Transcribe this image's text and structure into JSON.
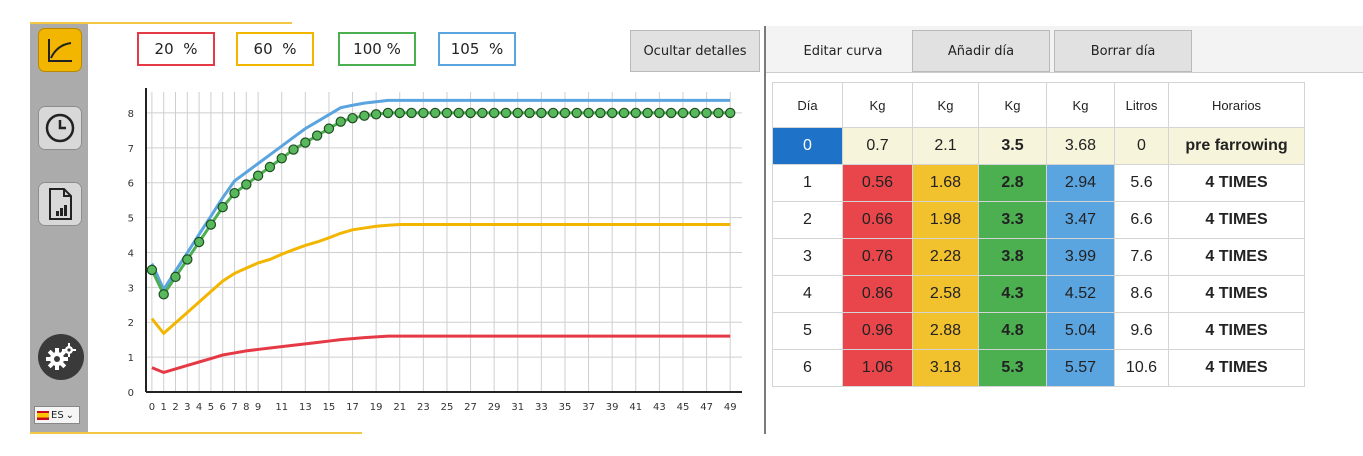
{
  "sidebar": {
    "icons": [
      "curve-chart-icon",
      "clock-icon",
      "report-file-icon",
      "gear-icon"
    ],
    "language_label": "ES"
  },
  "percent_filters": [
    {
      "value": "20",
      "unit": "%",
      "color": "#e63946"
    },
    {
      "value": "60",
      "unit": "%",
      "color": "#f2b600"
    },
    {
      "value": "100",
      "unit": "%",
      "color": "#4caf50"
    },
    {
      "value": "105",
      "unit": "%",
      "color": "#5aa4e0"
    }
  ],
  "buttons": {
    "hide_details": "Ocultar detalles",
    "edit_curve": "Editar curva",
    "add_day": "Añadir día",
    "delete_day": "Borrar día"
  },
  "table": {
    "headers": [
      "Día",
      "Kg",
      "Kg",
      "Kg",
      "Kg",
      "Litros",
      "Horarios"
    ],
    "rows": [
      [
        "0",
        "0.7",
        "2.1",
        "3.5",
        "3.68",
        "0",
        "pre farrowing"
      ],
      [
        "1",
        "0.56",
        "1.68",
        "2.8",
        "2.94",
        "5.6",
        "4 TIMES"
      ],
      [
        "2",
        "0.66",
        "1.98",
        "3.3",
        "3.47",
        "6.6",
        "4 TIMES"
      ],
      [
        "3",
        "0.76",
        "2.28",
        "3.8",
        "3.99",
        "7.6",
        "4 TIMES"
      ],
      [
        "4",
        "0.86",
        "2.58",
        "4.3",
        "4.52",
        "8.6",
        "4 TIMES"
      ],
      [
        "5",
        "0.96",
        "2.88",
        "4.8",
        "5.04",
        "9.6",
        "4 TIMES"
      ],
      [
        "6",
        "1.06",
        "3.18",
        "5.3",
        "5.57",
        "10.6",
        "4 TIMES"
      ]
    ],
    "column_colors": [
      "",
      "#e8464b",
      "#f2c12e",
      "#4caf50",
      "#5aa4e0",
      "",
      ""
    ]
  },
  "chart_data": {
    "type": "line",
    "x": [
      0,
      1,
      2,
      3,
      4,
      5,
      6,
      7,
      8,
      9,
      10,
      11,
      12,
      13,
      14,
      15,
      16,
      17,
      18,
      19,
      20,
      21,
      22,
      23,
      24,
      25,
      26,
      27,
      28,
      29,
      30,
      31,
      32,
      33,
      34,
      35,
      36,
      37,
      38,
      39,
      40,
      41,
      42,
      43,
      44,
      45,
      46,
      47,
      48,
      49
    ],
    "x_ticks": [
      0,
      1,
      2,
      3,
      4,
      5,
      6,
      7,
      8,
      9,
      11,
      13,
      15,
      17,
      19,
      21,
      23,
      25,
      27,
      29,
      31,
      33,
      35,
      37,
      39,
      41,
      43,
      45,
      47,
      49
    ],
    "y_ticks": [
      0,
      1,
      2,
      3,
      4,
      5,
      6,
      7,
      8
    ],
    "ylim": [
      0,
      8.6
    ],
    "xlim": [
      -0.5,
      50
    ],
    "grid": true,
    "series": [
      {
        "color": "#e63946",
        "values": [
          0.7,
          0.56,
          0.66,
          0.76,
          0.86,
          0.96,
          1.06,
          1.12,
          1.18,
          1.22,
          1.26,
          1.3,
          1.34,
          1.38,
          1.42,
          1.46,
          1.5,
          1.53,
          1.56,
          1.58,
          1.6,
          1.6,
          1.6,
          1.6,
          1.6,
          1.6,
          1.6,
          1.6,
          1.6,
          1.6,
          1.6,
          1.6,
          1.6,
          1.6,
          1.6,
          1.6,
          1.6,
          1.6,
          1.6,
          1.6,
          1.6,
          1.6,
          1.6,
          1.6,
          1.6,
          1.6,
          1.6,
          1.6,
          1.6,
          1.6
        ]
      },
      {
        "color": "#f2b600",
        "values": [
          2.1,
          1.68,
          1.98,
          2.28,
          2.58,
          2.88,
          3.18,
          3.4,
          3.55,
          3.7,
          3.8,
          3.95,
          4.08,
          4.2,
          4.3,
          4.42,
          4.55,
          4.65,
          4.7,
          4.75,
          4.78,
          4.8,
          4.8,
          4.8,
          4.8,
          4.8,
          4.8,
          4.8,
          4.8,
          4.8,
          4.8,
          4.8,
          4.8,
          4.8,
          4.8,
          4.8,
          4.8,
          4.8,
          4.8,
          4.8,
          4.8,
          4.8,
          4.8,
          4.8,
          4.8,
          4.8,
          4.8,
          4.8,
          4.8,
          4.8
        ]
      },
      {
        "color": "#4caf50",
        "values": [
          3.5,
          2.8,
          3.3,
          3.8,
          4.3,
          4.8,
          5.3,
          5.7,
          5.95,
          6.2,
          6.45,
          6.7,
          6.95,
          7.15,
          7.35,
          7.55,
          7.75,
          7.85,
          7.92,
          7.96,
          8.0,
          8.0,
          8.0,
          8.0,
          8.0,
          8.0,
          8.0,
          8.0,
          8.0,
          8.0,
          8.0,
          8.0,
          8.0,
          8.0,
          8.0,
          8.0,
          8.0,
          8.0,
          8.0,
          8.0,
          8.0,
          8.0,
          8.0,
          8.0,
          8.0,
          8.0,
          8.0,
          8.0,
          8.0,
          8.0
        ]
      },
      {
        "color": "#5aa4e0",
        "values": [
          3.68,
          2.94,
          3.47,
          3.99,
          4.52,
          5.04,
          5.57,
          6.05,
          6.3,
          6.55,
          6.8,
          7.05,
          7.3,
          7.55,
          7.75,
          7.95,
          8.15,
          8.22,
          8.28,
          8.32,
          8.36,
          8.36,
          8.36,
          8.36,
          8.36,
          8.36,
          8.36,
          8.36,
          8.36,
          8.36,
          8.36,
          8.36,
          8.36,
          8.36,
          8.36,
          8.36,
          8.36,
          8.36,
          8.36,
          8.36,
          8.36,
          8.36,
          8.36,
          8.36,
          8.36,
          8.36,
          8.36,
          8.36,
          8.36,
          8.36
        ]
      }
    ]
  }
}
